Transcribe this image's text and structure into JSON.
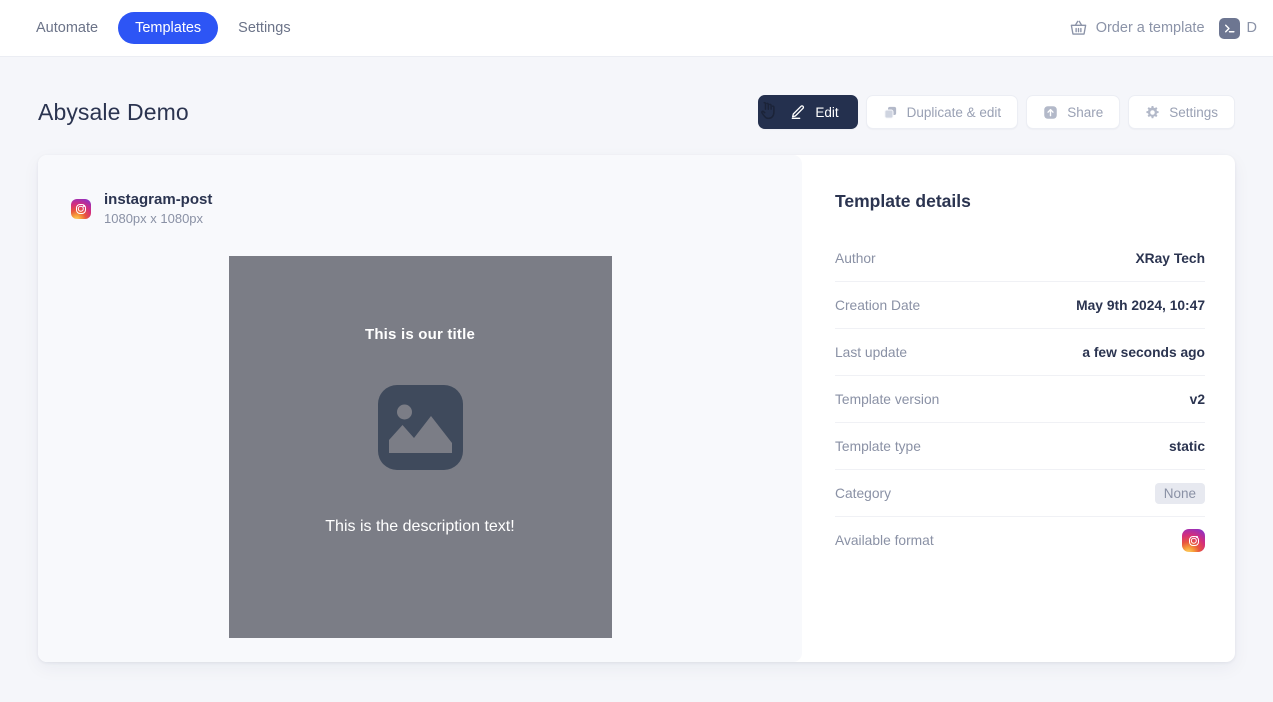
{
  "nav": {
    "items": [
      {
        "label": "Automate",
        "active": false
      },
      {
        "label": "Templates",
        "active": true
      },
      {
        "label": "Settings",
        "active": false
      }
    ],
    "order_label": "Order a template",
    "console_label": "D",
    "active_color": "#2d55f5"
  },
  "page": {
    "title": "Abysale Demo"
  },
  "actions": {
    "edit": "Edit",
    "duplicate": "Duplicate & edit",
    "share": "Share",
    "settings": "Settings"
  },
  "preview": {
    "format_name": "instagram-post",
    "format_size": "1080px x 1080px",
    "canvas": {
      "title": "This is our title",
      "description": "This is the description text!",
      "background_color": "#7b7d86",
      "placeholder_color": "#3f4a5c"
    }
  },
  "details": {
    "heading": "Template details",
    "rows": [
      {
        "label": "Author",
        "value": "XRay Tech",
        "type": "text"
      },
      {
        "label": "Creation Date",
        "value": "May 9th 2024, 10:47",
        "type": "text"
      },
      {
        "label": "Last update",
        "value": "a few seconds ago",
        "type": "text"
      },
      {
        "label": "Template version",
        "value": "v2",
        "type": "text"
      },
      {
        "label": "Template type",
        "value": "static",
        "type": "text"
      },
      {
        "label": "Category",
        "value": "None",
        "type": "badge"
      },
      {
        "label": "Available format",
        "value": "",
        "type": "icon"
      }
    ]
  }
}
